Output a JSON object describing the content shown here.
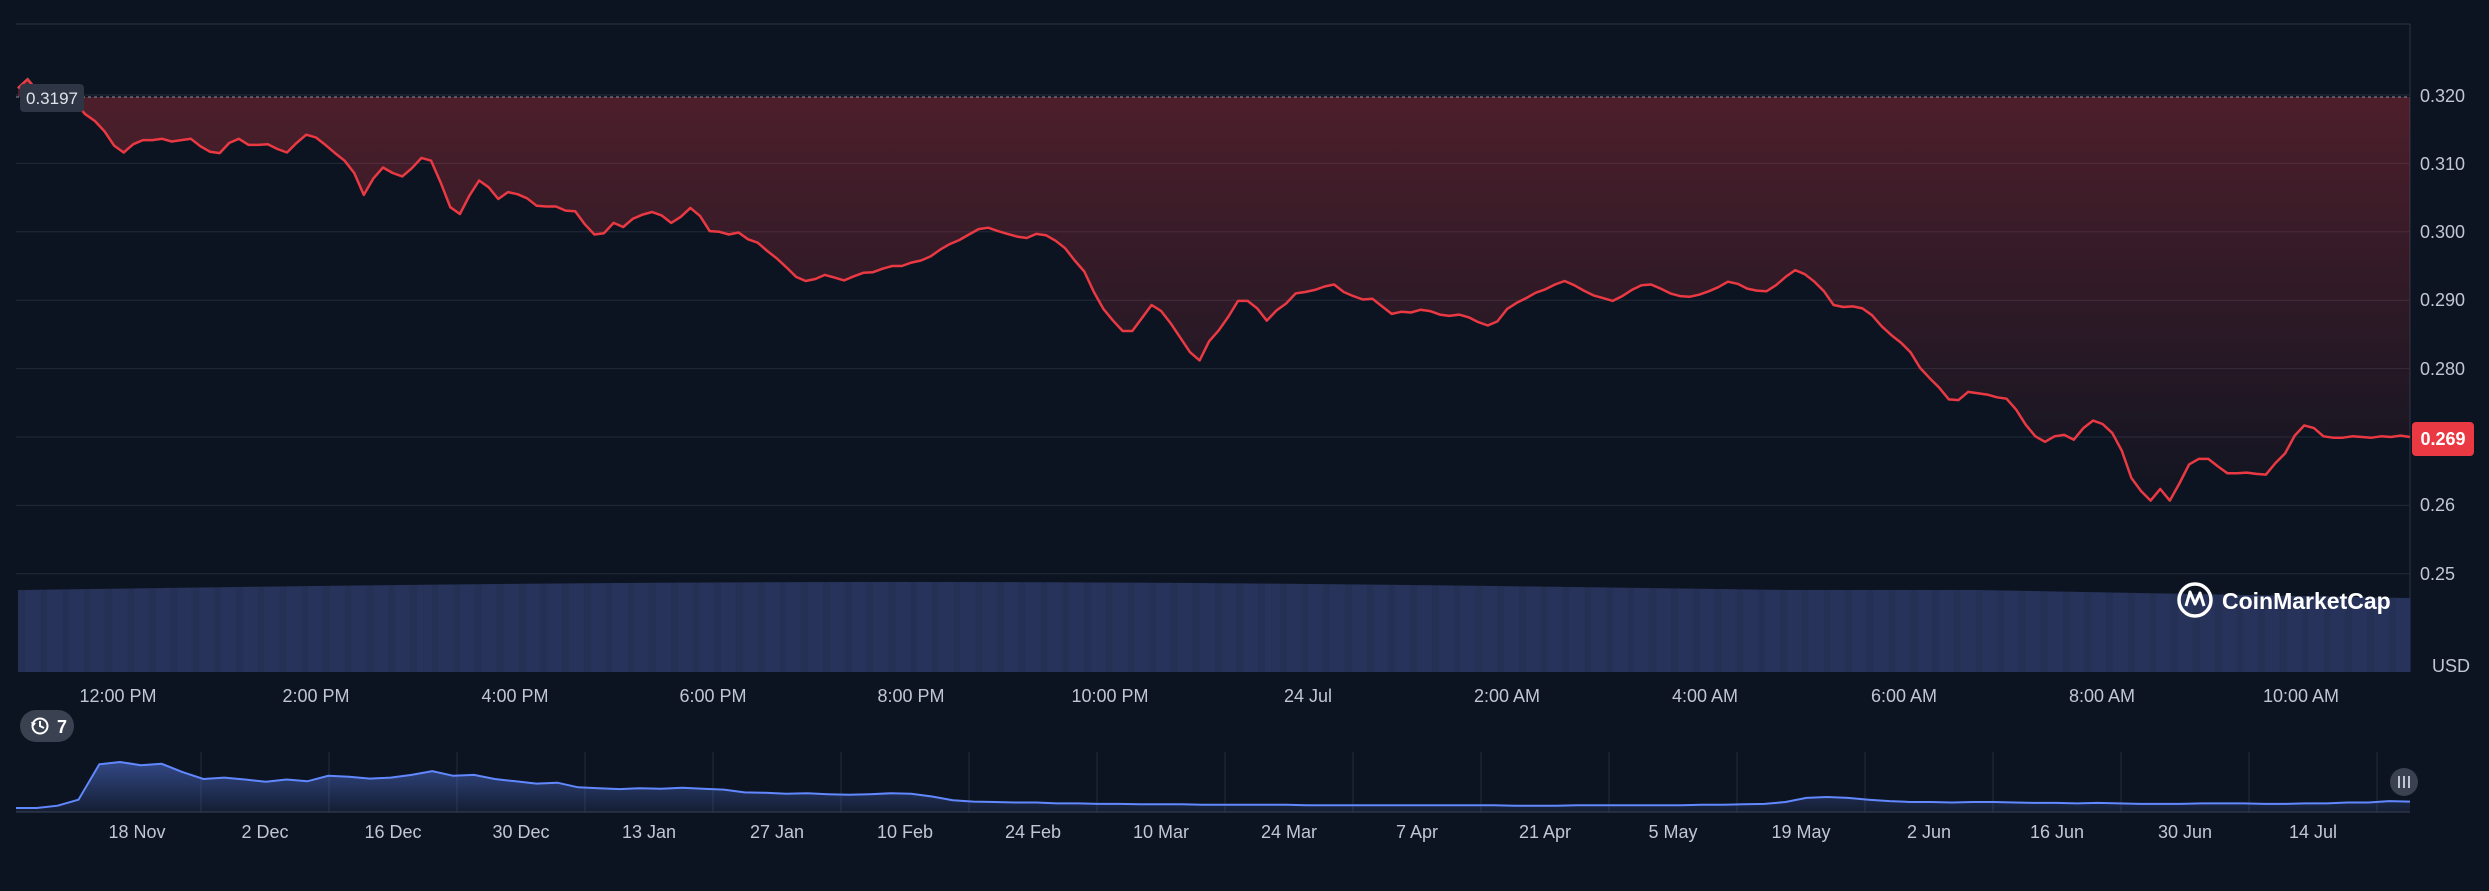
{
  "colors": {
    "background": "#0d1421",
    "price_line": "#ea3943",
    "price_up": "#16c784",
    "volume_bar": "#2a3660",
    "nav_line": "#6188ff",
    "grid": "#222a3a"
  },
  "price_axis": {
    "ticks": [
      "0.320",
      "0.310",
      "0.300",
      "0.290",
      "0.280",
      "0.26",
      "0.25"
    ],
    "currency": "USD",
    "current_price_label": "0.269",
    "open_price_label": "0.3197"
  },
  "brand": {
    "name": "CoinMarketCap",
    "logo_icon": "coinmarketcap-logo-icon"
  },
  "history_badge": {
    "icon": "history-icon",
    "label": "7"
  },
  "time_axis": {
    "labels": [
      "12:00 PM",
      "2:00 PM",
      "4:00 PM",
      "6:00 PM",
      "8:00 PM",
      "10:00 PM",
      "24 Jul",
      "2:00 AM",
      "4:00 AM",
      "6:00 AM",
      "8:00 AM",
      "10:00 AM"
    ]
  },
  "navigator": {
    "labels": [
      "18 Nov",
      "2 Dec",
      "16 Dec",
      "30 Dec",
      "13 Jan",
      "27 Jan",
      "10 Feb",
      "24 Feb",
      "10 Mar",
      "24 Mar",
      "7 Apr",
      "21 Apr",
      "5 May",
      "19 May",
      "2 Jun",
      "16 Jun",
      "30 Jun",
      "14 Jul"
    ],
    "handle_icon": "pause-handle-icon",
    "series": [
      0,
      0,
      0.05,
      0.18,
      0.95,
      1.0,
      0.93,
      0.96,
      0.78,
      0.63,
      0.66,
      0.62,
      0.57,
      0.62,
      0.58,
      0.7,
      0.68,
      0.64,
      0.66,
      0.72,
      0.8,
      0.7,
      0.72,
      0.63,
      0.58,
      0.53,
      0.55,
      0.45,
      0.43,
      0.41,
      0.43,
      0.42,
      0.44,
      0.42,
      0.4,
      0.34,
      0.33,
      0.31,
      0.32,
      0.3,
      0.29,
      0.3,
      0.32,
      0.31,
      0.25,
      0.17,
      0.14,
      0.13,
      0.12,
      0.12,
      0.1,
      0.1,
      0.09,
      0.09,
      0.08,
      0.08,
      0.08,
      0.07,
      0.07,
      0.07,
      0.07,
      0.07,
      0.06,
      0.06,
      0.06,
      0.06,
      0.06,
      0.06,
      0.06,
      0.06,
      0.06,
      0.06,
      0.05,
      0.05,
      0.05,
      0.06,
      0.06,
      0.06,
      0.06,
      0.06,
      0.06,
      0.07,
      0.07,
      0.08,
      0.09,
      0.13,
      0.22,
      0.24,
      0.22,
      0.18,
      0.15,
      0.13,
      0.13,
      0.12,
      0.13,
      0.13,
      0.12,
      0.11,
      0.11,
      0.1,
      0.11,
      0.1,
      0.09,
      0.09,
      0.09,
      0.1,
      0.1,
      0.1,
      0.09,
      0.09,
      0.1,
      0.1,
      0.12,
      0.12,
      0.15,
      0.14
    ]
  },
  "chart_data": {
    "type": "line",
    "title": "",
    "ylabel": "USD",
    "ylim": [
      0.25,
      0.324
    ],
    "x_labels": [
      "12:00 PM",
      "2:00 PM",
      "4:00 PM",
      "6:00 PM",
      "8:00 PM",
      "10:00 PM",
      "24 Jul",
      "2:00 AM",
      "4:00 AM",
      "6:00 AM",
      "8:00 AM",
      "10:00 AM"
    ],
    "open_price": 0.3197,
    "last_price": 0.269,
    "series": [
      {
        "values": [
          0.321,
          0.3223,
          0.3206,
          0.3197,
          0.3187,
          0.3183,
          0.3188,
          0.3172,
          0.3162,
          0.3147,
          0.3126,
          0.3116,
          0.3128,
          0.3134,
          0.3134,
          0.3136,
          0.3132,
          0.3134,
          0.3136,
          0.3125,
          0.3117,
          0.3115,
          0.313,
          0.3136,
          0.3127,
          0.3127,
          0.3128,
          0.3121,
          0.3116,
          0.313,
          0.3142,
          0.3138,
          0.3127,
          0.3115,
          0.3104,
          0.3086,
          0.3054,
          0.3078,
          0.3094,
          0.3086,
          0.3081,
          0.3093,
          0.3108,
          0.3104,
          0.3072,
          0.3036,
          0.3026,
          0.3053,
          0.3075,
          0.3065,
          0.3048,
          0.3058,
          0.3055,
          0.3049,
          0.3038,
          0.3037,
          0.3037,
          0.3031,
          0.303,
          0.3011,
          0.2996,
          0.2998,
          0.3013,
          0.3007,
          0.3019,
          0.3025,
          0.3029,
          0.3024,
          0.3013,
          0.3022,
          0.3035,
          0.3023,
          0.3001,
          0.3,
          0.2996,
          0.2999,
          0.2989,
          0.2984,
          0.2972,
          0.2961,
          0.2948,
          0.2934,
          0.2928,
          0.2931,
          0.2937,
          0.2933,
          0.2929,
          0.2935,
          0.294,
          0.2941,
          0.2946,
          0.295,
          0.295,
          0.2955,
          0.2958,
          0.2964,
          0.2974,
          0.2982,
          0.2988,
          0.2996,
          0.3004,
          0.3006,
          0.3001,
          0.2997,
          0.2993,
          0.2991,
          0.2997,
          0.2995,
          0.2987,
          0.2976,
          0.2958,
          0.2942,
          0.2912,
          0.2887,
          0.287,
          0.2855,
          0.2855,
          0.2874,
          0.2893,
          0.2884,
          0.2866,
          0.2845,
          0.2824,
          0.2812,
          0.284,
          0.2856,
          0.2876,
          0.2899,
          0.2899,
          0.2888,
          0.287,
          0.2885,
          0.2895,
          0.291,
          0.2912,
          0.2915,
          0.292,
          0.2923,
          0.2912,
          0.2906,
          0.2901,
          0.2902,
          0.2891,
          0.288,
          0.2883,
          0.2882,
          0.2886,
          0.2884,
          0.2879,
          0.2877,
          0.2879,
          0.2875,
          0.2868,
          0.2863,
          0.2869,
          0.2887,
          0.2896,
          0.2903,
          0.2911,
          0.2916,
          0.2923,
          0.2928,
          0.2922,
          0.2914,
          0.2907,
          0.2903,
          0.2899,
          0.2906,
          0.2915,
          0.2922,
          0.2923,
          0.2917,
          0.291,
          0.2906,
          0.2905,
          0.2908,
          0.2913,
          0.2919,
          0.2927,
          0.2924,
          0.2917,
          0.2914,
          0.2913,
          0.2922,
          0.2934,
          0.2944,
          0.2938,
          0.2927,
          0.2913,
          0.2893,
          0.289,
          0.2891,
          0.2888,
          0.2878,
          0.2862,
          0.2849,
          0.2838,
          0.2824,
          0.2801,
          0.2786,
          0.2772,
          0.2755,
          0.2754,
          0.2766,
          0.2764,
          0.2762,
          0.2758,
          0.2756,
          0.274,
          0.2718,
          0.2701,
          0.2693,
          0.2701,
          0.2703,
          0.2696,
          0.2713,
          0.2724,
          0.2719,
          0.2706,
          0.268,
          0.264,
          0.2621,
          0.2607,
          0.2624,
          0.2607,
          0.2632,
          0.266,
          0.2668,
          0.2668,
          0.2657,
          0.2647,
          0.2647,
          0.2648,
          0.2646,
          0.2645,
          0.2662,
          0.2676,
          0.2702,
          0.2717,
          0.2713,
          0.2701,
          0.2699,
          0.2699,
          0.2701,
          0.27,
          0.2699,
          0.2701,
          0.27,
          0.2702,
          0.27
        ]
      }
    ]
  }
}
